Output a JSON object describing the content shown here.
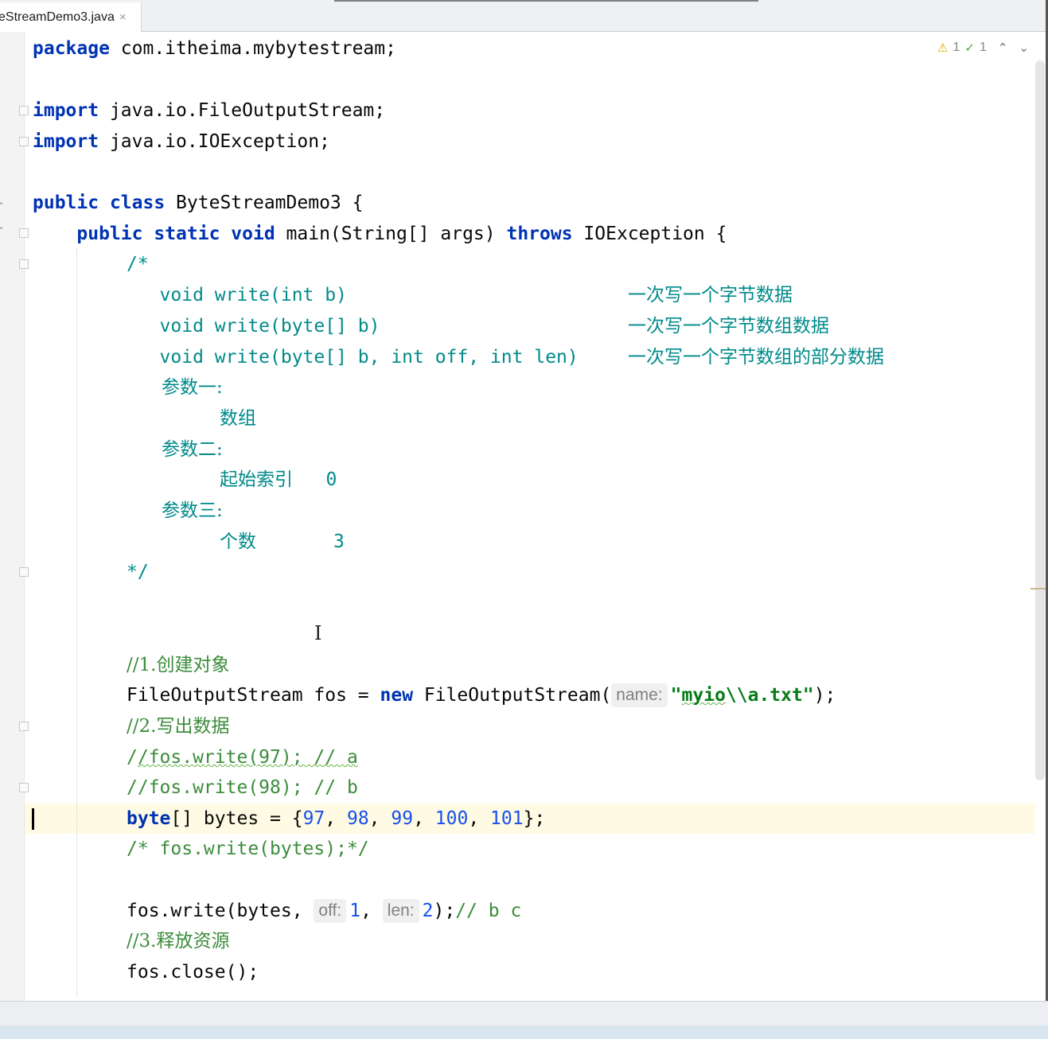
{
  "tab": {
    "label": "eStreamDemo3.java",
    "close": "×"
  },
  "inspections": {
    "warnings": "1",
    "checks": "1",
    "warn_icon": "warning-triangle-icon",
    "check_icon": "double-check-icon"
  },
  "code": {
    "l1": [
      "package",
      " com.itheima.mybytestream;"
    ],
    "l3": [
      "import",
      " java.io.FileOutputStream;"
    ],
    "l4": [
      "import",
      " java.io.IOException;"
    ],
    "l6": [
      "public",
      " ",
      "class",
      " ByteStreamDemo3 {"
    ],
    "l7": [
      "    ",
      "public",
      " ",
      "static",
      " ",
      "void",
      " main(String[] args) ",
      "throws",
      " IOException {"
    ],
    "l8": "/*",
    "l9a": "   void write(int b)                   ",
    "l9b": "一次写一个字节数据",
    "l10a": "   void write(byte[] b)                ",
    "l10b": "一次写一个字节数组数据",
    "l11a": "   void write(byte[] b, int off, int len)  ",
    "l11b": "一次写一个字节数组的部分数据",
    "l12": "参数一:",
    "l13": "数组",
    "l14": "参数二:",
    "l15a": "起始索引",
    "l15b": "0",
    "l16": "参数三:",
    "l17a": "个数",
    "l17b": "3",
    "l18": "*/",
    "l21": "//1.创建对象",
    "l22a": "FileOutputStream fos = ",
    "l22kw": "new",
    "l22b": " FileOutputStream(",
    "l22hint": "name:",
    "l22q1": "\"",
    "l22s1": "myio",
    "l22s2": "\\\\a.txt\"",
    "l22c": ");",
    "l23": "//2.写出数据",
    "l24a": "/",
    "l24b": "/fos.write(97); // a",
    "l25": "//fos.write(98); // b",
    "l26kw": "byte",
    "l26a": "[] bytes = {",
    "l26n1": "97",
    "l26n2": "98",
    "l26n3": "99",
    "l26n4": "100",
    "l26n5": "101",
    "l26sep": ", ",
    "l26b": "};",
    "l27": "/* fos.write(bytes);*/",
    "l29a": "fos.write(bytes, ",
    "l29h1": "off:",
    "l29n1": "1",
    "l29sep": ", ",
    "l29h2": "len:",
    "l29n2": "2",
    "l29b": ");",
    "l29c": "// b c",
    "l30": "//3.释放资源",
    "l31": "fos.close();"
  }
}
